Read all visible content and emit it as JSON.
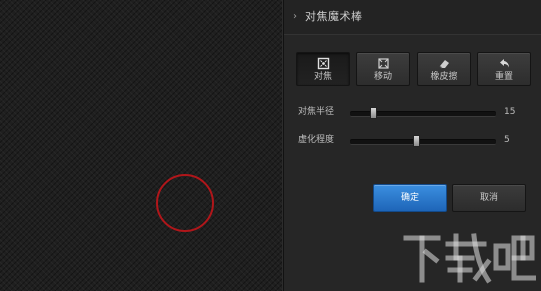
{
  "panel": {
    "title": "对焦魔术棒"
  },
  "tools": [
    {
      "label": "对焦",
      "icon": "focus-icon",
      "active": true
    },
    {
      "label": "移动",
      "icon": "move-icon",
      "active": false
    },
    {
      "label": "橡皮擦",
      "icon": "eraser-icon",
      "active": false
    },
    {
      "label": "重置",
      "icon": "reset-arrow-icon",
      "active": false
    }
  ],
  "sliders": {
    "focus_radius": {
      "label": "对焦半径",
      "value": "15",
      "fraction": 0.16
    },
    "blur_level": {
      "label": "虚化程度",
      "value": "5",
      "fraction": 0.45
    }
  },
  "actions": {
    "confirm": "确定",
    "cancel": "取消"
  },
  "watermark": {
    "text": "下载吧"
  },
  "colors": {
    "focus_ring": "#b0161a",
    "confirm_button": "#2a78cf",
    "panel_background": "#262626"
  }
}
